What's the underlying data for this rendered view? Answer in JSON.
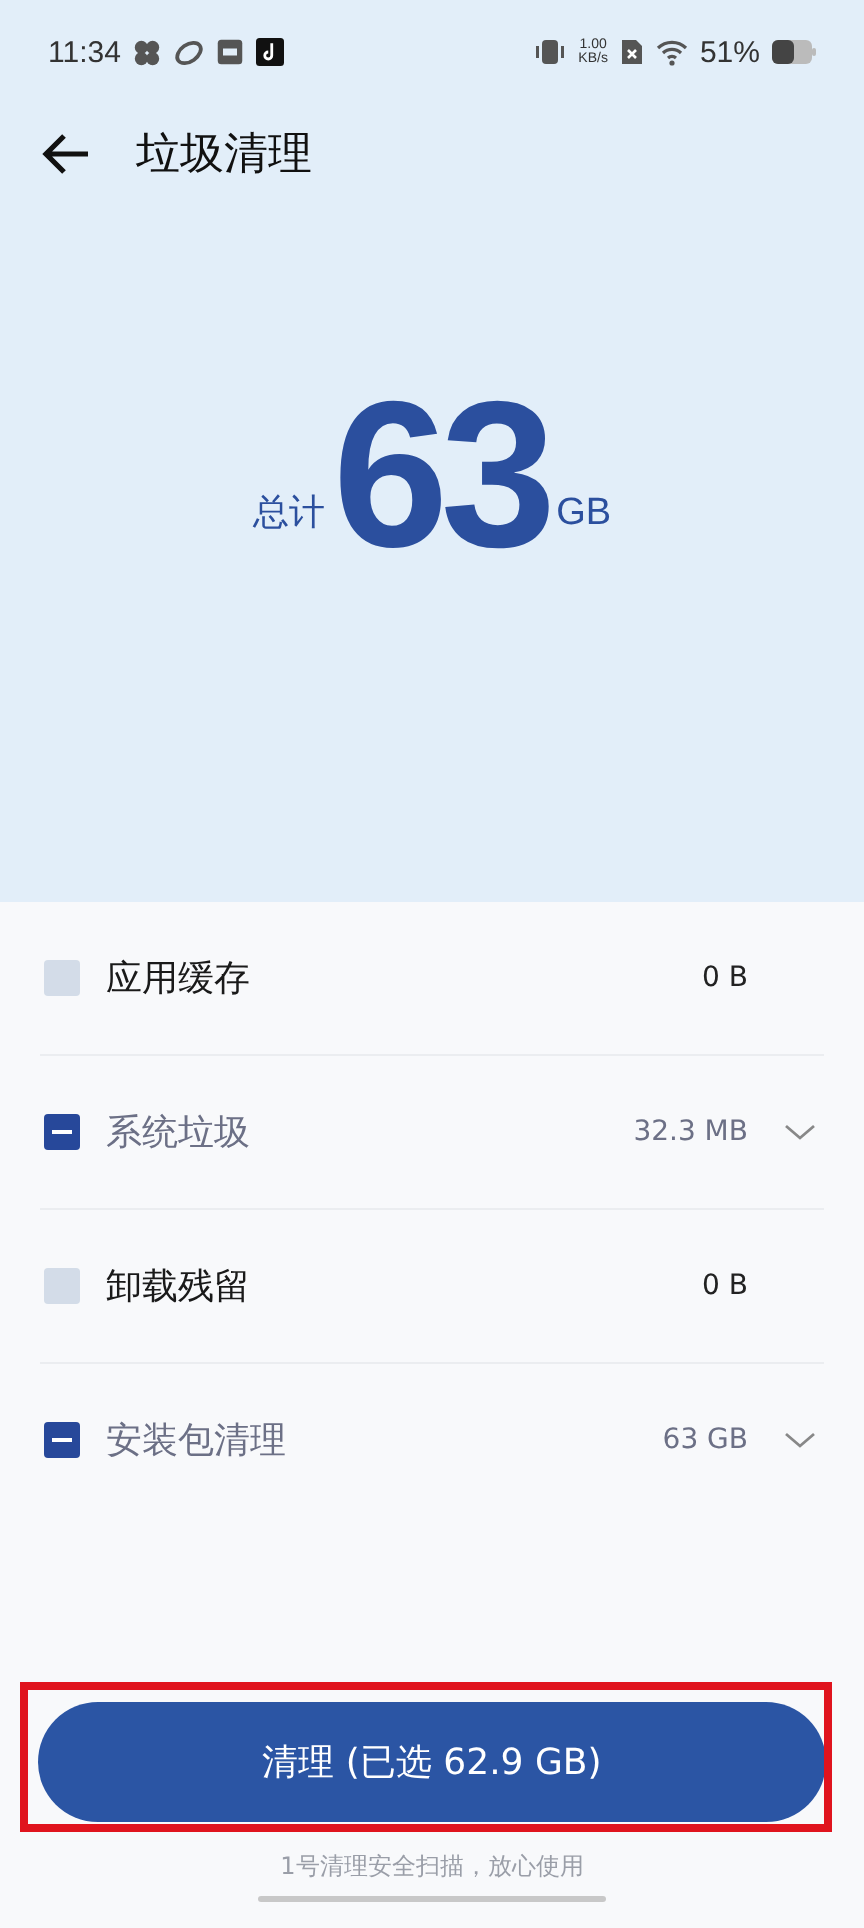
{
  "status_bar": {
    "time": "11:34",
    "net_speed_value": "1.00",
    "net_speed_unit": "KB/s",
    "battery": "51%"
  },
  "header": {
    "title": "垃圾清理"
  },
  "summary": {
    "prefix": "总计",
    "value": "63",
    "unit": "GB"
  },
  "items": [
    {
      "label": "应用缓存",
      "size": "0 B",
      "partial": false,
      "expandable": false
    },
    {
      "label": "系统垃圾",
      "size": "32.3 MB",
      "partial": true,
      "expandable": true
    },
    {
      "label": "卸载残留",
      "size": "0 B",
      "partial": false,
      "expandable": false
    },
    {
      "label": "安装包清理",
      "size": "63 GB",
      "partial": true,
      "expandable": true
    }
  ],
  "clean_button": {
    "label": "清理 (已选 62.9 GB)",
    "highlighted": true
  },
  "footnote": "1号清理安全扫描，放心使用"
}
